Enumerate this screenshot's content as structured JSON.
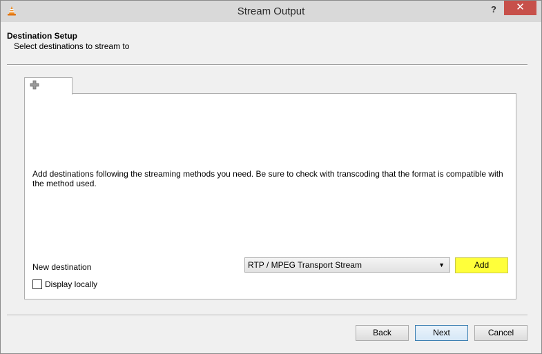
{
  "window": {
    "title": "Stream Output",
    "help_label": "?",
    "close_label": "✕"
  },
  "header": {
    "title": "Destination Setup",
    "subtitle": "Select destinations to stream to"
  },
  "tabs": [
    {
      "icon": "plus-icon"
    }
  ],
  "panel": {
    "info": "Add destinations following the streaming methods you need. Be sure to check with transcoding that the format is compatible with the method used.",
    "new_destination_label": "New destination",
    "destination_select": "RTP / MPEG Transport Stream",
    "add_label": "Add",
    "display_locally_label": "Display locally",
    "display_locally_checked": false
  },
  "footer": {
    "back_label": "Back",
    "next_label": "Next",
    "cancel_label": "Cancel"
  },
  "colors": {
    "add_highlight": "#ffff3a",
    "close_red": "#c7504a",
    "titlebar": "#d9d9d9"
  }
}
